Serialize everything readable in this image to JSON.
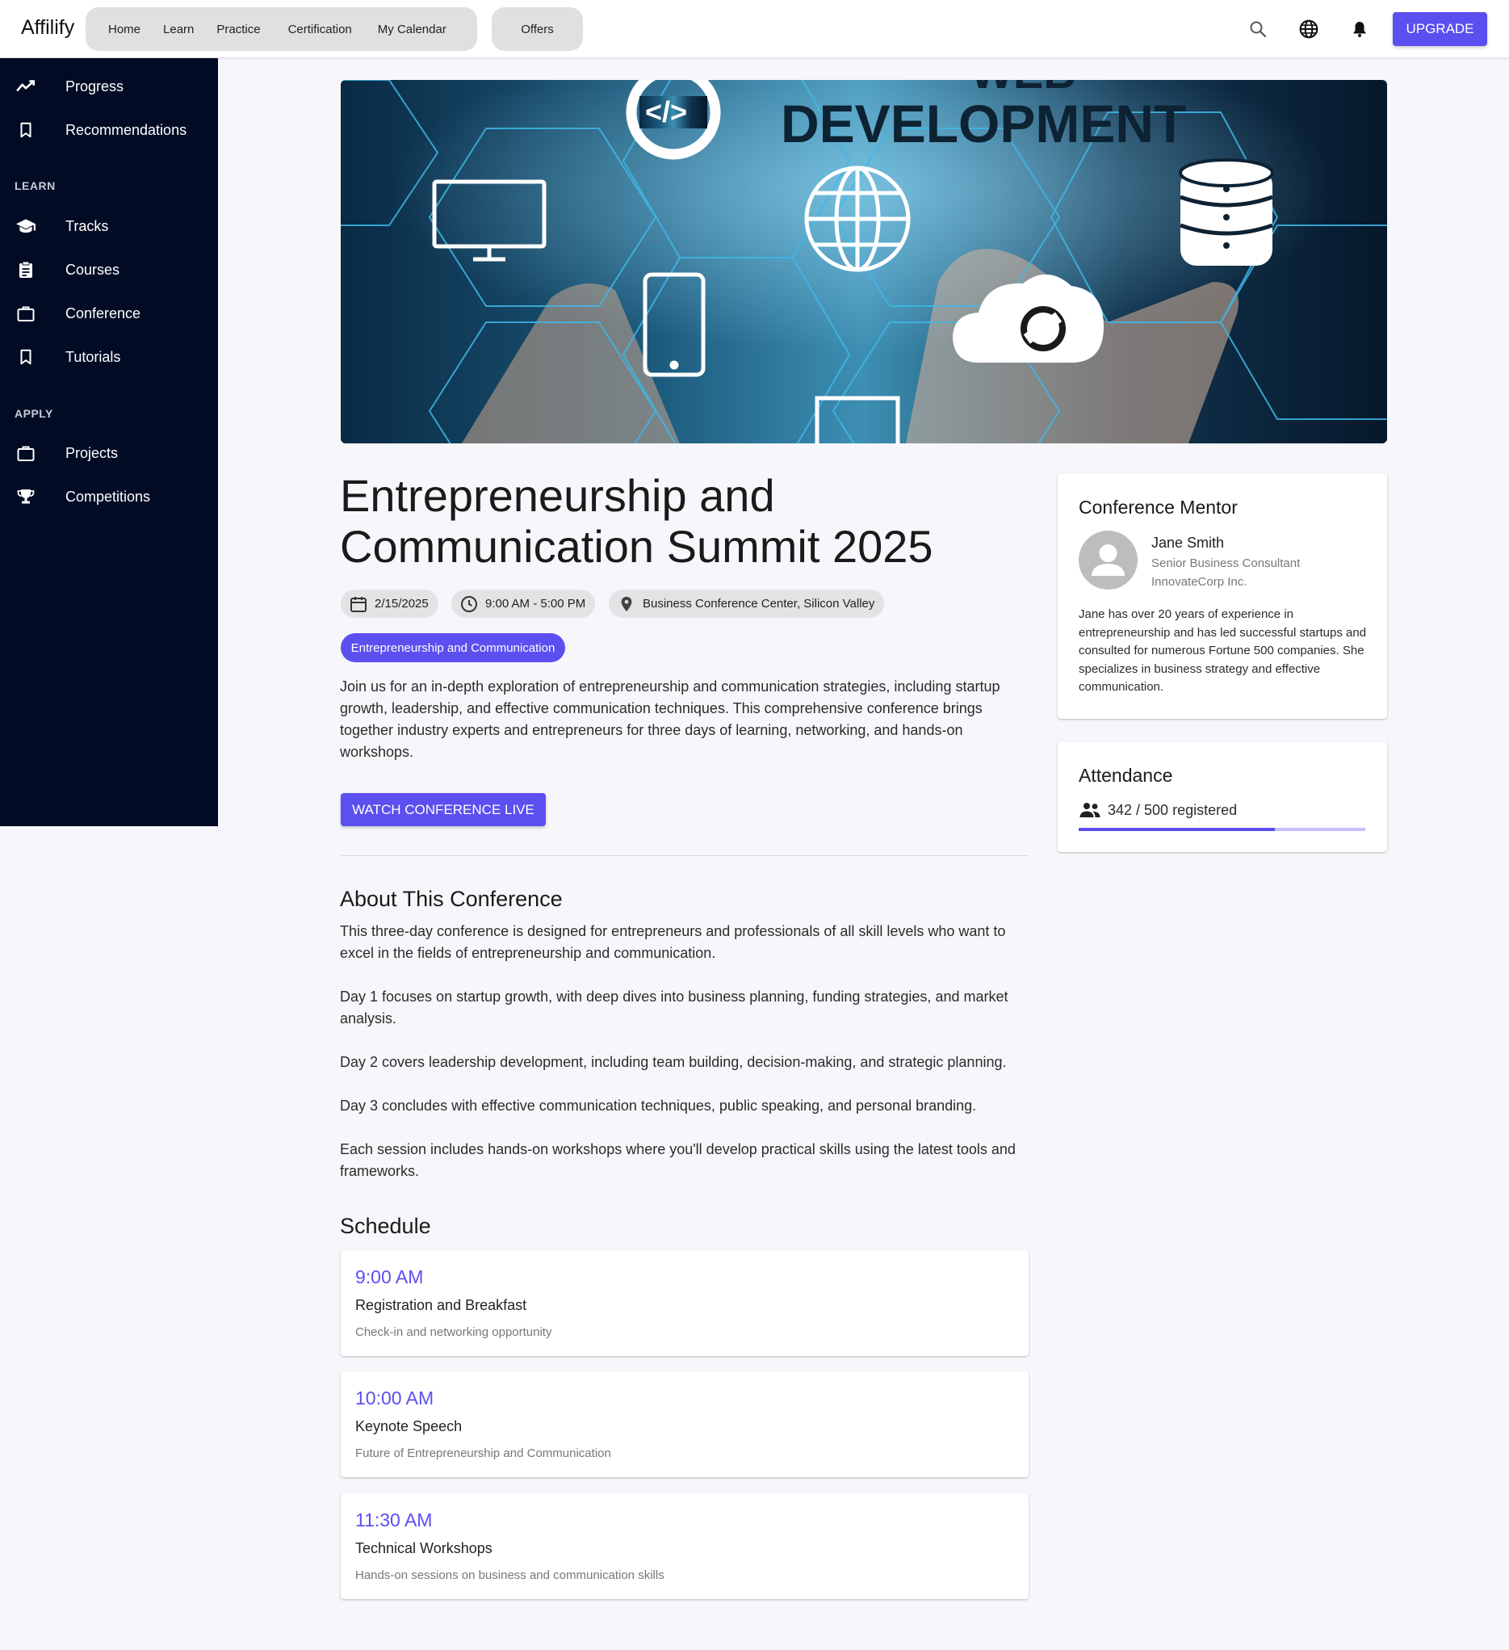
{
  "app": {
    "brand": "Affilify"
  },
  "topnav": {
    "links": [
      "Home",
      "Learn",
      "Practice",
      "Certification",
      "My Calendar"
    ],
    "offers": "Offers",
    "upgrade_label": "UPGRADE",
    "icons": [
      "search-icon",
      "globe-icon",
      "bell-icon"
    ]
  },
  "sidebar": {
    "items": [
      {
        "label": "Progress",
        "icon": "trending-up-icon"
      },
      {
        "label": "Recommendations",
        "icon": "bookmark-icon"
      }
    ],
    "learn_heading": "LEARN",
    "learn_items": [
      {
        "label": "Tracks",
        "icon": "graduation-cap-icon"
      },
      {
        "label": "Courses",
        "icon": "clipboard-icon"
      },
      {
        "label": "Conference",
        "icon": "briefcase-icon"
      },
      {
        "label": "Tutorials",
        "icon": "bookmark-icon"
      }
    ],
    "apply_heading": "APPLY",
    "apply_items": [
      {
        "label": "Projects",
        "icon": "briefcase-icon"
      },
      {
        "label": "Competitions",
        "icon": "trophy-icon"
      }
    ]
  },
  "hero": {
    "text_top": "WEB",
    "text_main": "DEVELOPMENT"
  },
  "conference": {
    "title": "Entrepreneurship and Communication Summit 2025",
    "date": "2/15/2025",
    "time": "9:00 AM - 5:00 PM",
    "location": "Business Conference Center, Silicon Valley",
    "tag": "Entrepreneurship and Communication",
    "description": "Join us for an in-depth exploration of entrepreneurship and communication strategies, including startup growth, leadership, and effective communication techniques. This comprehensive conference brings together industry experts and entrepreneurs for three days of learning, networking, and hands-on workshops.",
    "watch_label": "WATCH CONFERENCE LIVE"
  },
  "about": {
    "heading": "About This Conference",
    "paragraphs": [
      "This three-day conference is designed for entrepreneurs and professionals of all skill levels who want to excel in the fields of entrepreneurship and communication.",
      "Day 1 focuses on startup growth, with deep dives into business planning, funding strategies, and market analysis.",
      "Day 2 covers leadership development, including team building, decision-making, and strategic planning.",
      "Day 3 concludes with effective communication techniques, public speaking, and personal branding.",
      "Each session includes hands-on workshops where you'll develop practical skills using the latest tools and frameworks."
    ]
  },
  "schedule": {
    "heading": "Schedule",
    "items": [
      {
        "time": "9:00 AM",
        "title": "Registration and Breakfast",
        "desc": "Check-in and networking opportunity"
      },
      {
        "time": "10:00 AM",
        "title": "Keynote Speech",
        "desc": "Future of Entrepreneurship and Communication"
      },
      {
        "time": "11:30 AM",
        "title": "Technical Workshops",
        "desc": "Hands-on sessions on business and communication skills"
      }
    ]
  },
  "mentor": {
    "heading": "Conference Mentor",
    "name": "Jane Smith",
    "role": "Senior Business Consultant",
    "org": "InnovateCorp Inc.",
    "bio": "Jane has over 20 years of experience in entrepreneurship and has led successful startups and consulted for numerous Fortune 500 companies. She specializes in business strategy and effective communication."
  },
  "attendance": {
    "heading": "Attendance",
    "text": "342 / 500 registered",
    "registered": 342,
    "capacity": 500
  },
  "colors": {
    "accent": "#5b4ff0",
    "sidebar_bg": "#020b24",
    "page_bg": "#f7f7fb"
  }
}
